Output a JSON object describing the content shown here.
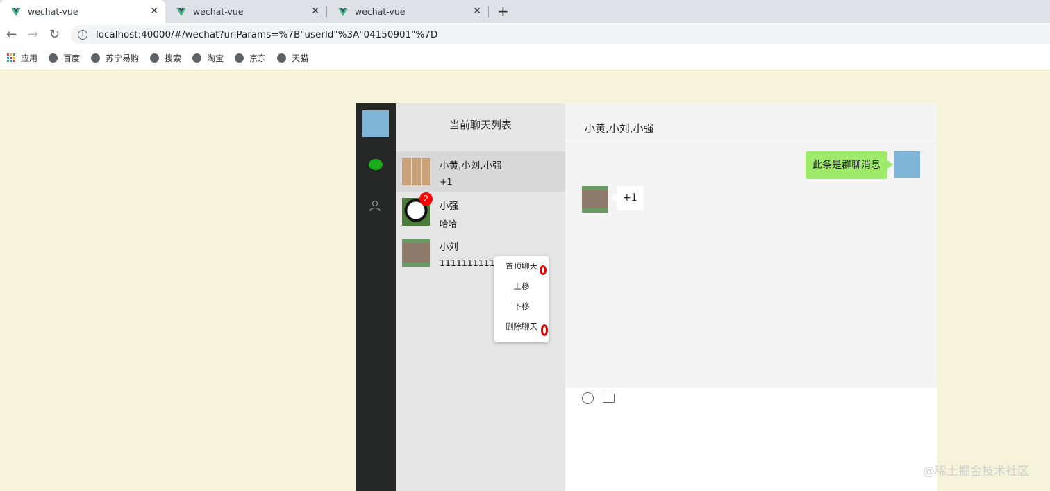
{
  "browser": {
    "tabs": [
      {
        "title": "wechat-vue"
      },
      {
        "title": "wechat-vue"
      },
      {
        "title": "wechat-vue"
      }
    ],
    "url": "localhost:40000/#/wechat?urlParams=%7B\"userId\"%3A\"04150901\"%7D",
    "bookmarks": [
      "应用",
      "百度",
      "苏宁易购",
      "搜索",
      "淘宝",
      "京东",
      "天猫"
    ]
  },
  "chat_list": {
    "title": "当前聊天列表",
    "items": [
      {
        "name": "小黄,小刘,小强",
        "last_message": "+1"
      },
      {
        "name": "小强",
        "last_message": "哈哈",
        "unread": "2"
      },
      {
        "name": "小刘",
        "last_message": "1111111111111111"
      }
    ]
  },
  "context_menu": {
    "items": [
      "置顶聊天",
      "上移",
      "下移",
      "删除聊天"
    ]
  },
  "conversation": {
    "title": "小黄,小刘,小强",
    "messages": [
      {
        "direction": "out",
        "text": "此条是群聊消息"
      },
      {
        "direction": "in",
        "text": "+1"
      }
    ]
  },
  "watermark": "@稀土掘金技术社区",
  "colors": {
    "page_bg": "#f5f4da",
    "nav_bg": "#252827",
    "list_bg": "#e6e6e6",
    "out_bubble": "#9eea6a",
    "badge": "#ff0000",
    "accent": "#1aad19"
  }
}
